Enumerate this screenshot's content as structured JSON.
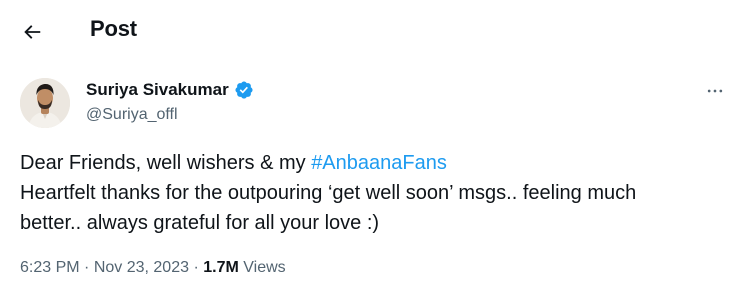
{
  "header": {
    "title": "Post",
    "back_icon": "arrow-left-icon"
  },
  "author": {
    "name": "Suriya Sivakumar",
    "handle": "@Suriya_offl",
    "verified_icon": "verified-badge-icon",
    "verified_color": "#1d9bf0"
  },
  "tweet": {
    "line1_prefix": "Dear Friends, well wishers & my ",
    "hashtag": "#AnbaanaFans",
    "line2": "Heartfelt thanks for the outpouring ‘get well soon’ msgs.. feeling much",
    "line3": "better.. always grateful for all your love :)",
    "hashtag_color": "#1d9bf0"
  },
  "meta": {
    "time": "6:23 PM",
    "separator": " · ",
    "date": "Nov 23, 2023",
    "views_count": "1.7M",
    "views_label": "Views"
  },
  "more_icon": "more-horizontal-icon"
}
